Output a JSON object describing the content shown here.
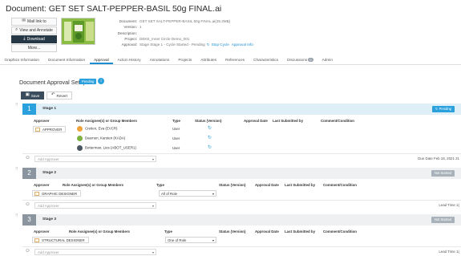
{
  "document": {
    "title_prefix": "Document:",
    "title": "GET SET SALT-PEPPER-BASIL 50g FINAL.ai"
  },
  "actions": {
    "mail_link": "Mail link to",
    "view_annotate": "View and Annotate",
    "download": "Download",
    "more": "More..."
  },
  "meta": {
    "document_label": "Document:",
    "document_value": "GET SET SALT-PEPPER-BASIL 50g FINAL.ai(25.2MB)",
    "version_label": "Version:",
    "version_value": "1",
    "description_label": "Description:",
    "description_value": "",
    "project_label": "Project:",
    "project_value": "DEKE_Inner Circle Demo_001",
    "approval_label": "Approval:",
    "approval_value": "Stage Stage 1 - Cycle Started - Pending",
    "stop_cycle": "Stop Cycle",
    "approval_info": "Approval Info"
  },
  "tabs": [
    {
      "label": "Graphics Information"
    },
    {
      "label": "Document Information"
    },
    {
      "label": "Approval"
    },
    {
      "label": "Action History"
    },
    {
      "label": "Annotations"
    },
    {
      "label": "Projects"
    },
    {
      "label": "Attributes"
    },
    {
      "label": "References"
    },
    {
      "label": "Characteristics"
    },
    {
      "label": "Discussions",
      "count": "0"
    },
    {
      "label": "Admin"
    }
  ],
  "setup": {
    "title": "Document Approval Setup",
    "status": "Pending",
    "save": "Save",
    "revert": "Revert"
  },
  "stage1": {
    "num": "1",
    "name": "Stage 1",
    "status": "Pending",
    "headers": {
      "approver": "Approver",
      "role": "Role Assignee(s) or Group Members",
      "type": "Type",
      "status": "Status (Version)",
      "approval_date": "Approval Date",
      "last_submitted": "Last Submitted by",
      "comment": "Comment/Condition"
    },
    "role": "APPROVER",
    "members": [
      {
        "name": "Cretien, Eva (EVCR)",
        "type": "User",
        "color": "#f0a23c"
      },
      {
        "name": "Daemen, Karsten (KADA)",
        "type": "User",
        "color": "#7bb241"
      },
      {
        "name": "Botterman, Lies (ABOT_USER1)",
        "type": "User",
        "color": "#4a5560"
      }
    ],
    "add_placeholder": "Add Approver",
    "due": "Due Date Feb 18, 2021 21"
  },
  "stage2": {
    "num": "2",
    "name": "Stage 2",
    "status": "Not Started",
    "headers": {
      "approver": "Approver",
      "role": "Role Assignee(s) or Group Members",
      "type": "Type",
      "status": "Status (Version)",
      "approval_date": "Approval Date",
      "last_submitted": "Last Submitted by",
      "comment": "Comment/Condition"
    },
    "role": "GRAPHIC DESIGNER",
    "type_value": "All of Role",
    "add_placeholder": "Add Approver",
    "lead": "Lead Time 1("
  },
  "stage3": {
    "num": "3",
    "name": "Stage 3",
    "status": "Not Started",
    "headers": {
      "approver": "Approver",
      "role": "Role Assignee(s) or Group Members",
      "type": "Type",
      "status": "Status (Version)",
      "approval_date": "Approval Date",
      "last_submitted": "Last Submitted by",
      "comment": "Comment/Condition"
    },
    "role": "STRUCTURAL DESIGNER",
    "type_value": "One of Role",
    "add_placeholder": "Add Approver",
    "lead": "Lead Time 1("
  }
}
